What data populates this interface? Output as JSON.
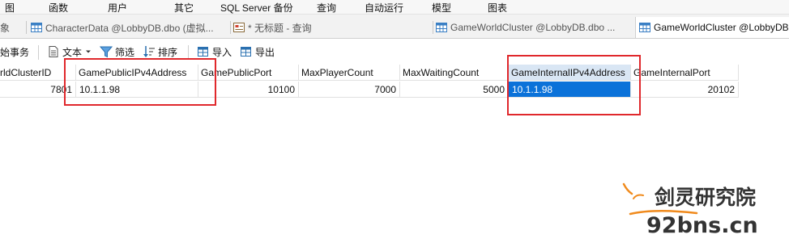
{
  "menu": [
    "图",
    "函数",
    "用户",
    "其它",
    "SQL Server 备份",
    "查询",
    "自动运行",
    "模型",
    "图表"
  ],
  "tabs": [
    {
      "label": "象"
    },
    {
      "label": "CharacterData @LobbyDB.dbo (虚拟..."
    },
    {
      "label": "* 无标题 - 查询"
    },
    {
      "label": "GameWorldCluster @LobbyDB.dbo ..."
    },
    {
      "label": "GameWorldCluster @LobbyDB"
    }
  ],
  "toolbar": {
    "transaction_label": "始事务",
    "text_label": "文本",
    "filter_label": "筛选",
    "sort_label": "排序",
    "import_label": "导入",
    "export_label": "导出"
  },
  "grid": {
    "columns": [
      "rldClusterID",
      "GamePublicIPv4Address",
      "GamePublicPort",
      "MaxPlayerCount",
      "MaxWaitingCount",
      "GameInternalIPv4Address",
      "GameInternalPort"
    ],
    "rows": [
      [
        "7801",
        "10.1.1.98",
        "10100",
        "7000",
        "5000",
        "10.1.1.98",
        "20102"
      ]
    ],
    "selected_column": "GameInternalIPv4Address"
  },
  "watermark": {
    "brand": "剑灵研究院",
    "domain": "92bns.cn"
  },
  "colors": {
    "highlight": "#e0282c",
    "selection": "#0b72d9",
    "watermark_orange": "#f08a1c",
    "watermark_dark": "#333333"
  }
}
